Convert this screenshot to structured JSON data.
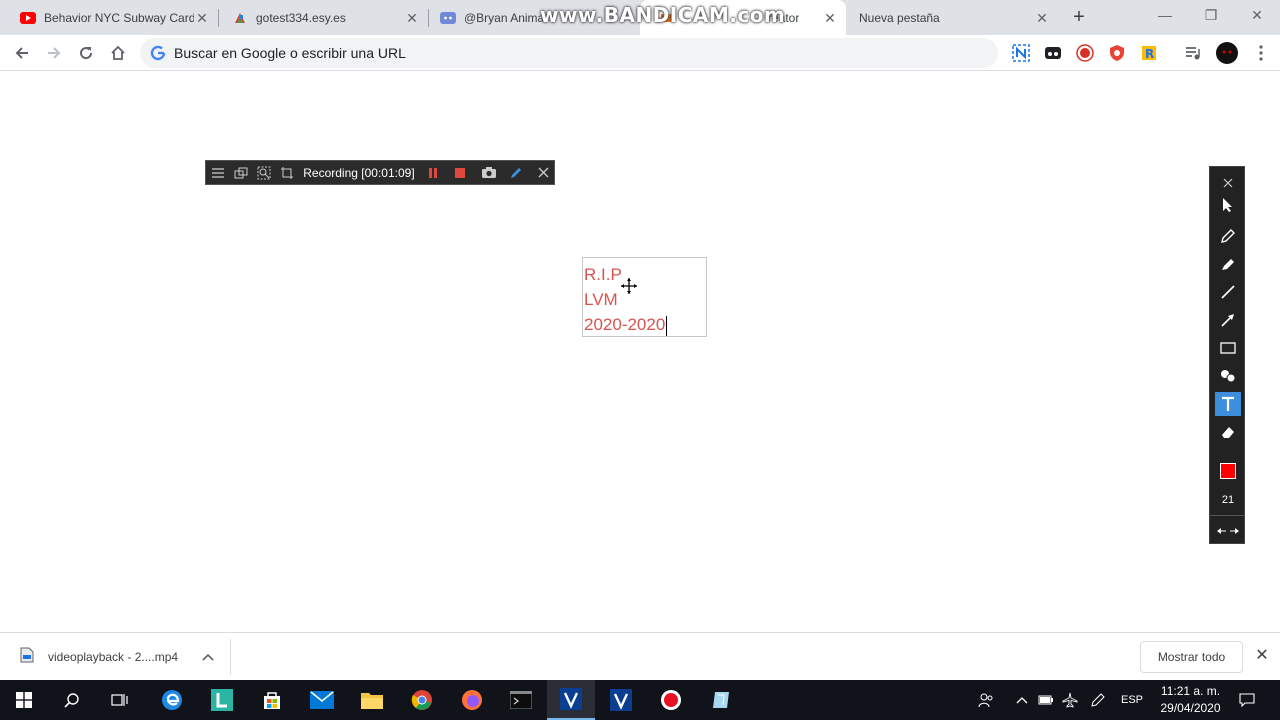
{
  "browser": {
    "tabs": [
      {
        "title": "Behavior NYC Subway Card",
        "favicon": "youtube-icon",
        "active": false
      },
      {
        "title": "gotest334.esy.es",
        "favicon": "colorful-icon",
        "active": false
      },
      {
        "title": "@Bryan Anima",
        "favicon": "discord-icon",
        "active": false
      },
      {
        "title": "reator",
        "favicon": "scratch-icon",
        "active": true
      },
      {
        "title": "Nueva pestaña",
        "favicon": "",
        "active": false
      }
    ],
    "new_tab_label": "+",
    "omnibox_placeholder": "Buscar en Google o escribir una URL"
  },
  "watermark": "www.BANDICAM.com",
  "recorder": {
    "status": "Recording [00:01:09]"
  },
  "canvas_text": {
    "line1": "R.I.P",
    "line2": "LVM",
    "line3": "2020-2020"
  },
  "draw_panel": {
    "size_value": "21",
    "selected_color": "#ff0000"
  },
  "downloads": {
    "item_name": "videoplayback - 2....mp4",
    "show_all_label": "Mostrar todo"
  },
  "taskbar": {
    "language": "ESP",
    "time": "11:21 a. m.",
    "date": "29/04/2020"
  },
  "colors": {
    "accent_blue": "#3d8fdd",
    "text_red": "#d9534f",
    "record_red": "#e81123"
  }
}
